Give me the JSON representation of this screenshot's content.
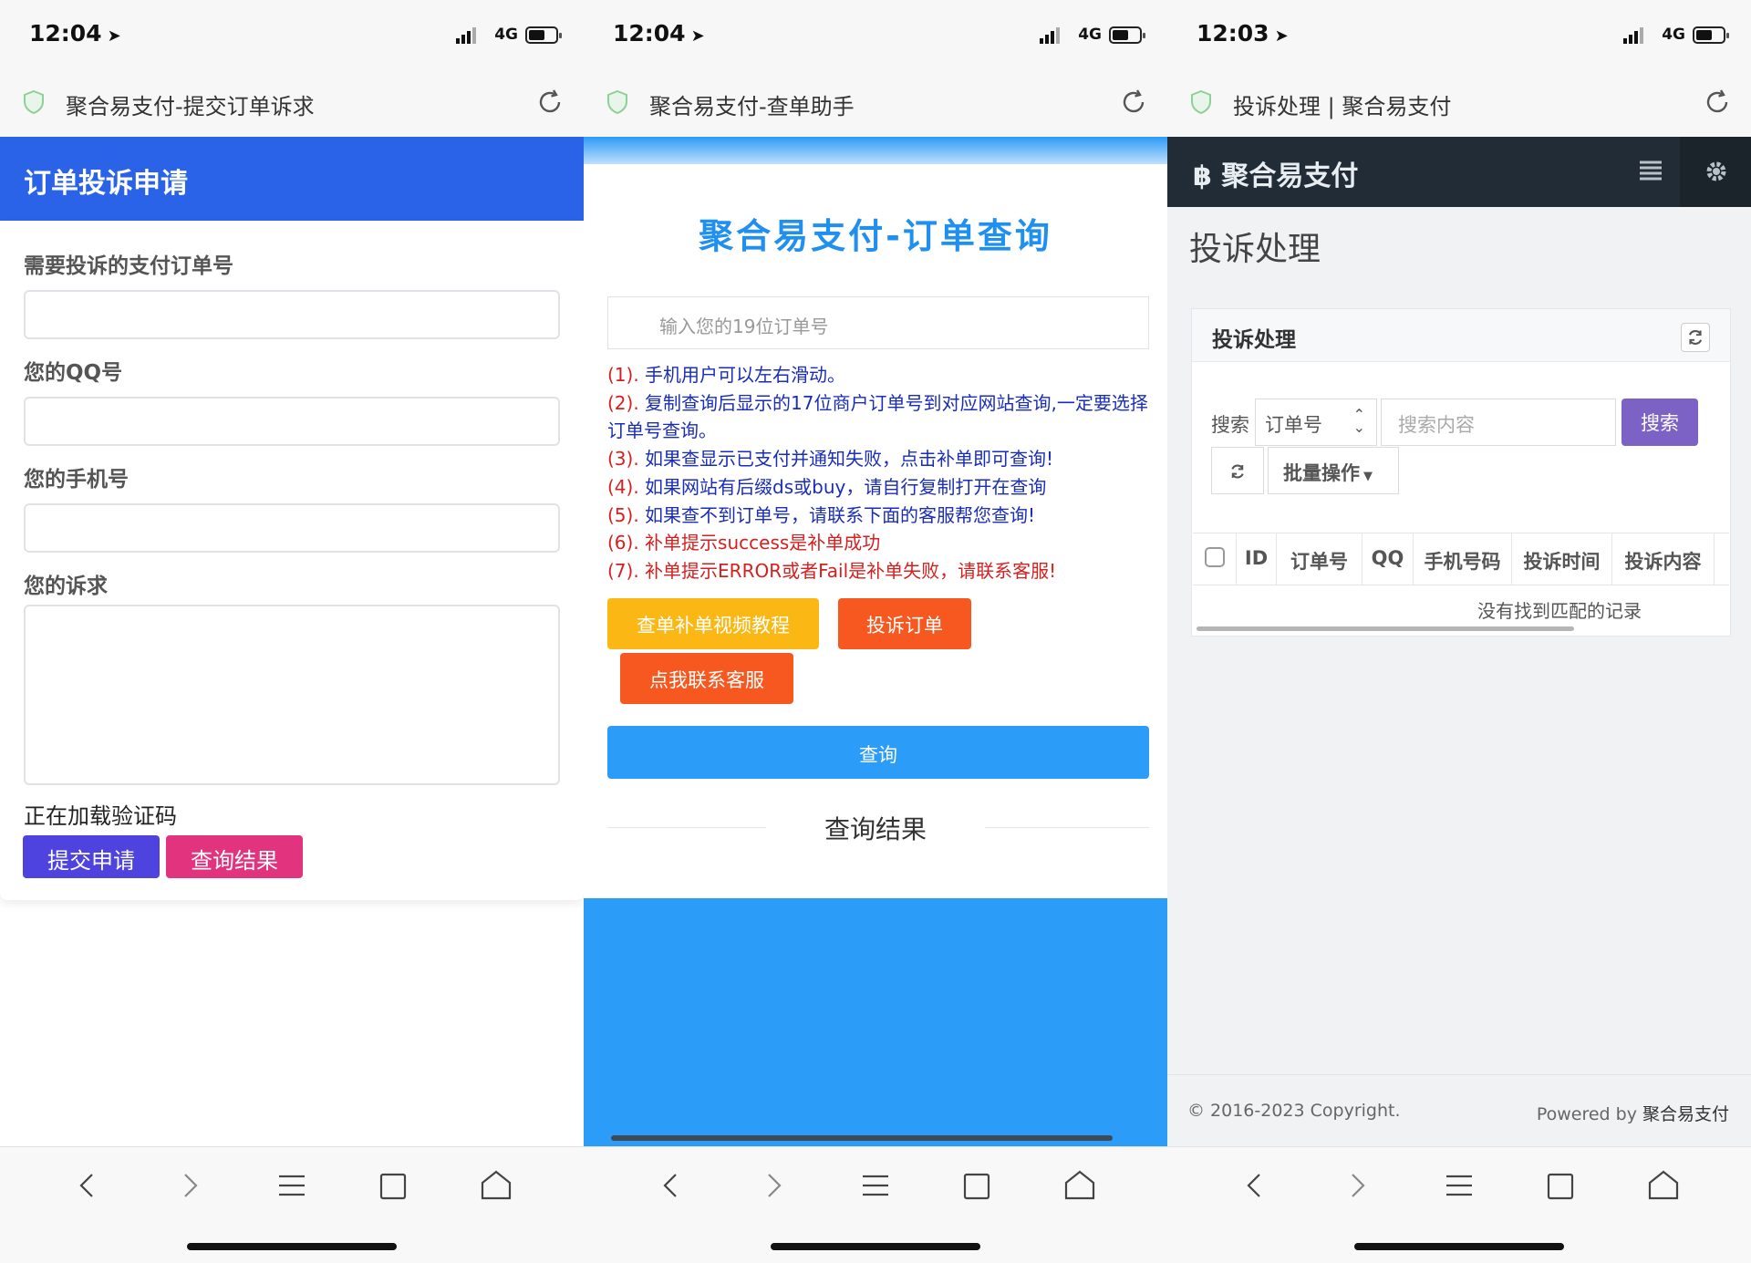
{
  "screens": [
    {
      "status": {
        "time": "12:04",
        "network": "4G"
      },
      "address": {
        "title": "聚合易支付-提交订单诉求"
      },
      "header": {
        "title": "订单投诉申请"
      },
      "form": {
        "order_label": "需要投诉的支付订单号",
        "qq_label": "您的QQ号",
        "phone_label": "您的手机号",
        "appeal_label": "您的诉求",
        "captcha_status": "正在加载验证码",
        "submit_button": "提交申请",
        "query_button": "查询结果"
      }
    },
    {
      "status": {
        "time": "12:04",
        "network": "4G"
      },
      "address": {
        "title": "聚合易支付-查单助手"
      },
      "title": "聚合易支付-订单查询",
      "search_placeholder": "输入您的19位订单号",
      "tips": [
        {
          "num": "(1).",
          "text": "手机用户可以左右滑动。",
          "red": false
        },
        {
          "num": "(2).",
          "text": "复制查询后显示的17位商户订单号到对应网站查询,一定要选择订单号查询。",
          "red": false
        },
        {
          "num": "(3).",
          "text": "如果查显示已支付并通知失败，点击补单即可查询!",
          "red": false
        },
        {
          "num": "(4).",
          "text": "如果网站有后缀ds或buy，请自行复制打开在查询",
          "red": false
        },
        {
          "num": "(5).",
          "text": "如果查不到订单号，请联系下面的客服帮您查询!",
          "red": false
        },
        {
          "num": "(6).",
          "text": "补单提示success是补单成功",
          "red": true
        },
        {
          "num": "(7).",
          "text": "补单提示ERROR或者Fail是补单失败，请联系客服!",
          "red": true
        }
      ],
      "buttons": {
        "tutorial": "查单补单视频教程",
        "complain": "投诉订单",
        "contact": "点我联系客服",
        "query": "查询"
      },
      "result_title": "查询结果",
      "colors": {
        "primary": "#2b9cf8",
        "tutorial": "#fbb814",
        "orange": "#f6581f"
      }
    },
    {
      "status": {
        "time": "12:03",
        "network": "4G"
      },
      "address": {
        "title": "投诉处理 | 聚合易支付"
      },
      "brand": "聚合易支付",
      "page_title": "投诉处理",
      "panel_title": "投诉处理",
      "search_label": "搜索",
      "search_field": "订单号",
      "search_placeholder": "搜索内容",
      "search_button": "搜索",
      "batch_button": "批量操作",
      "table": {
        "columns": [
          "ID",
          "订单号",
          "QQ",
          "手机号码",
          "投诉时间",
          "投诉内容"
        ],
        "empty": "没有找到匹配的记录"
      },
      "footer": {
        "copyright": "© 2016-2023 Copyright.",
        "powered_prefix": "Powered by ",
        "powered_name": "聚合易支付"
      }
    }
  ]
}
